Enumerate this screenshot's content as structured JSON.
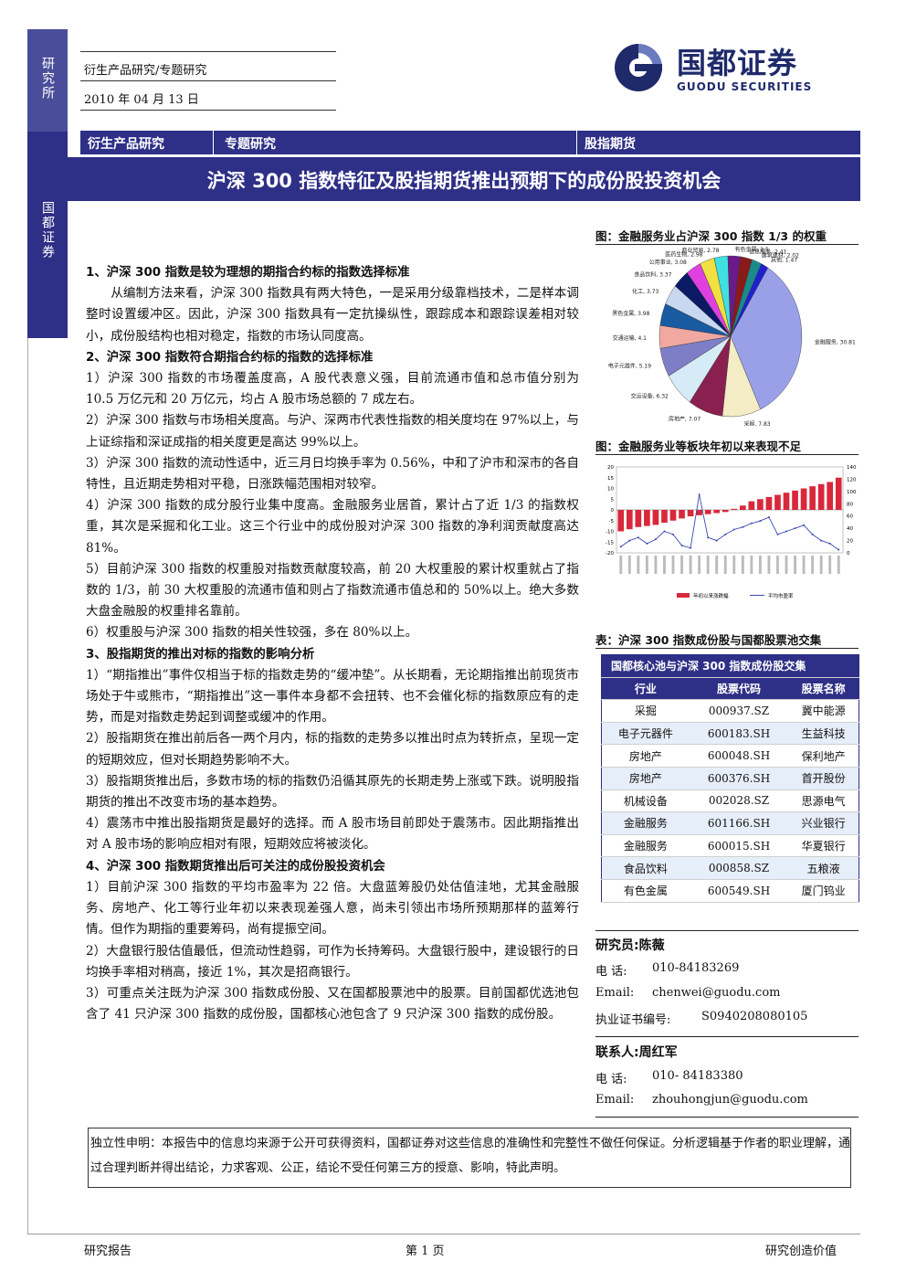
{
  "sidebar": {
    "top_label": "研究所",
    "mid_label": "国都证券"
  },
  "header": {
    "category_line": "衍生产品研究/专题研究",
    "date": "2010 年 04 月 13 日"
  },
  "logo": {
    "cn": "国都证券",
    "en": "GUODU SECURITIES",
    "brand_color": "#1f2a6b"
  },
  "category_bar": {
    "c1": "衍生产品研究",
    "c2": "专题研究",
    "c3": "股指期货",
    "color": "#2e2f86"
  },
  "title": "沪深 300 指数特征及股指期货推出预期下的成份股投资机会",
  "body": [
    {
      "t": "h",
      "text": "1、沪深 300 指数是较为理想的期指合约标的指数选择标准"
    },
    {
      "t": "ind",
      "text": "从编制方法来看，沪深 300 指数具有两大特色，一是采用分级靠档技术，二是样本调整时设置缓冲区。因此，沪深 300 指数具有一定抗操纵性，跟踪成本和跟踪误差相对较小，成份股结构也相对稳定，指数的市场认同度高。"
    },
    {
      "t": "h",
      "text": "2、沪深 300 指数符合期指合约标的指数的选择标准"
    },
    {
      "t": "p",
      "text": "1）沪深 300 指数的市场覆盖度高，A 股代表意义强，目前流通市值和总市值分别为 10.5 万亿元和 20 万亿元，均占 A 股市场总额的 7 成左右。"
    },
    {
      "t": "p",
      "text": "2）沪深 300 指数与市场相关度高。与沪、深两市代表性指数的相关度均在 97%以上，与上证综指和深证成指的相关度更是高达 99%以上。"
    },
    {
      "t": "p",
      "text": "3）沪深 300 指数的流动性适中，近三月日均换手率为 0.56%，中和了沪市和深市的各自特性，且近期走势相对平稳，日涨跌幅范围相对较窄。"
    },
    {
      "t": "p",
      "text": "4）沪深 300 指数的成分股行业集中度高。金融服务业居首，累计占了近 1/3 的指数权重，其次是采掘和化工业。这三个行业中的成份股对沪深 300 指数的净利润贡献度高达 81%。"
    },
    {
      "t": "p",
      "text": "5）目前沪深 300 指数的权重股对指数贡献度较高，前 20 大权重股的累计权重就占了指数的 1/3，前 30 大权重股的流通市值和则占了指数流通市值总和的 50%以上。绝大多数大盘金融股的权重排名靠前。"
    },
    {
      "t": "p",
      "text": "6）权重股与沪深 300 指数的相关性较强，多在 80%以上。"
    },
    {
      "t": "h",
      "text": "3、股指期货的推出对标的指数的影响分析"
    },
    {
      "t": "p",
      "text": "1）“期指推出”事件仅相当于标的指数走势的“缓冲垫”。从长期看，无论期指推出前现货市场处于牛或熊市，“期指推出”这一事件本身都不会扭转、也不会催化标的指数原应有的走势，而是对指数走势起到调整或缓冲的作用。"
    },
    {
      "t": "p",
      "text": "2）股指期货在推出前后各一两个月内，标的指数的走势多以推出时点为转折点，呈现一定的短期效应，但对长期趋势影响不大。"
    },
    {
      "t": "p",
      "text": "3）股指期货推出后，多数市场的标的指数仍沿循其原先的长期走势上涨或下跌。说明股指期货的推出不改变市场的基本趋势。"
    },
    {
      "t": "p",
      "text": "4）震荡市中推出股指期货是最好的选择。而 A 股市场目前即处于震荡市。因此期指推出对 A 股市场的影响应相对有限，短期效应将被淡化。"
    },
    {
      "t": "h",
      "text": "4、沪深 300 指数期货推出后可关注的成份股投资机会"
    },
    {
      "t": "p",
      "text": "1）目前沪深 300 指数的平均市盈率为 22 倍。大盘蓝筹股仍处估值洼地，尤其金融服务、房地产、化工等行业年初以来表现差强人意，尚未引领出市场所预期那样的蓝筹行情。但作为期指的重要筹码，尚有提振空间。"
    },
    {
      "t": "p",
      "text": "2）大盘银行股估值最低，但流动性趋弱，可作为长持筹码。大盘银行股中，建设银行的日均换手率相对稍高，接近 1%，其次是招商银行。"
    },
    {
      "t": "p",
      "text": "3）可重点关注既为沪深 300 指数成份股、又在国都股票池中的股票。目前国都优选池包含了 41 只沪深 300 指数的成份股，国都核心池包含了 9 只沪深 300 指数的成份股。"
    }
  ],
  "fig1_title": "图：金融服务业占沪深 300 指数 1/3 的权重",
  "fig2_title": "图：金融服务业等板块年初以来表现不足",
  "table_title": "表：沪深 300 指数成份股与国都股票池交集",
  "pie_chart": {
    "type": "pie",
    "slices": [
      {
        "label": "金融服务",
        "value": 30.81,
        "color": "#9aa0e8"
      },
      {
        "label": "采掘",
        "value": 7.83,
        "color": "#f3ecc4"
      },
      {
        "label": "房地产",
        "value": 7.07,
        "color": "#8a2050"
      },
      {
        "label": "交运设备",
        "value": 6.32,
        "color": "#d5ecf7"
      },
      {
        "label": "电子元器件",
        "value": 5.19,
        "color": "#7e7ec7"
      },
      {
        "label": "交通运输",
        "value": 4.1,
        "color": "#f0a8a0"
      },
      {
        "label": "黑色金属",
        "value": 3.98,
        "color": "#1a5aa0"
      },
      {
        "label": "化工",
        "value": 3.73,
        "color": "#c8d8f0"
      },
      {
        "label": "食品饮料",
        "value": 3.37,
        "color": "#0c1a66"
      },
      {
        "label": "公用事业",
        "value": 3.08,
        "color": "#e040e0"
      },
      {
        "label": "医药生物",
        "value": 2.98,
        "color": "#f0e040"
      },
      {
        "label": "商业贸易",
        "value": 2.78,
        "color": "#40e0e0"
      },
      {
        "label": "有色金属",
        "value": 2.5,
        "color": "#6a1a8a"
      },
      {
        "label": "信息服务",
        "value": 2.41,
        "color": "#8a1a1a"
      },
      {
        "label": "建筑建材",
        "value": 2.02,
        "color": "#1a8a8a"
      },
      {
        "label": "其他",
        "value": 1.47,
        "color": "#2020d0"
      }
    ]
  },
  "bar_chart": {
    "type": "bar",
    "left_ticks": [
      "20",
      "15",
      "10",
      "5",
      "0",
      "-5",
      "-10",
      "-15",
      "-20"
    ],
    "right_ticks": [
      "140",
      "120",
      "100",
      "80",
      "60",
      "40",
      "20",
      "0"
    ],
    "ylim_left": [
      -20,
      20
    ],
    "ylim_right": [
      0,
      140
    ],
    "bar_values": [
      -10,
      -9,
      -8,
      -7.5,
      -7,
      -6,
      -5,
      -4,
      -3,
      -2.5,
      -2,
      -1.5,
      -1,
      0.5,
      2,
      4,
      5,
      6,
      7,
      8,
      9,
      10,
      11,
      12,
      13,
      15
    ],
    "line_values": [
      10,
      20,
      25,
      15,
      22,
      35,
      30,
      12,
      8,
      95,
      25,
      20,
      30,
      38,
      42,
      48,
      52,
      58,
      30,
      35,
      40,
      45,
      30,
      20,
      15,
      5
    ],
    "bar_color": "#d8283a",
    "line_color": "#3a4ab0",
    "legend": [
      "年初以来涨跌幅",
      "平均市盈率"
    ]
  },
  "stock_table": {
    "caption": "国都核心池与沪深 300 指数成份股交集",
    "headers": [
      "行业",
      "股票代码",
      "股票名称"
    ],
    "rows": [
      [
        "采掘",
        "000937.SZ",
        "冀中能源"
      ],
      [
        "电子元器件",
        "600183.SH",
        "生益科技"
      ],
      [
        "房地产",
        "600048.SH",
        "保利地产"
      ],
      [
        "房地产",
        "600376.SH",
        "首开股份"
      ],
      [
        "机械设备",
        "002028.SZ",
        "思源电气"
      ],
      [
        "金融服务",
        "601166.SH",
        "兴业银行"
      ],
      [
        "金融服务",
        "600015.SH",
        "华夏银行"
      ],
      [
        "食品饮料",
        "000858.SZ",
        "五粮液"
      ],
      [
        "有色金属",
        "600549.SH",
        "厦门钨业"
      ]
    ]
  },
  "analyst": {
    "title": "研究员:陈薇",
    "phone_label": "电 话:",
    "phone": "010-84183269",
    "email_label": "Email:",
    "email": "chenwei@guodu.com",
    "cert_label": "执业证书编号:",
    "cert": "S0940208080105"
  },
  "contact": {
    "title": "联系人:周红军",
    "phone_label": "电 话:",
    "phone": "010- 84183380",
    "email_label": "Email:",
    "email": "zhouhongjun@guodu.com"
  },
  "disclaimer": "独立性申明：本报告中的信息均来源于公开可获得资料，国都证券对这些信息的准确性和完整性不做任何保证。分析逻辑基于作者的职业理解，通过合理判断并得出结论，力求客观、公正，结论不受任何第三方的授意、影响，特此声明。",
  "footer": {
    "left": "研究报告",
    "center": "第 1 页",
    "right": "研究创造价值"
  }
}
